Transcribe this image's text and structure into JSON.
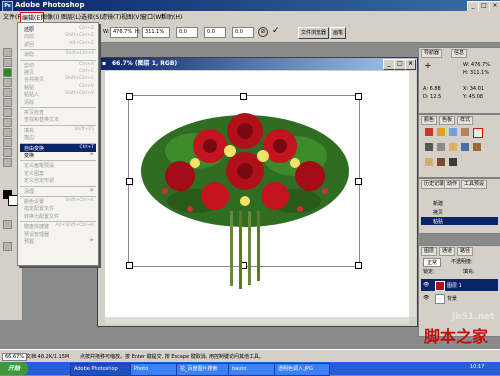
{
  "window": {
    "title": "Adobe Photoshop",
    "app_icon": "ps-logo-icon"
  },
  "menubar": [
    "文件(F)",
    "编辑(E)",
    "图像(I)",
    "图层(L)",
    "选择(S)",
    "滤镜(T)",
    "视图(V)",
    "窗口(W)",
    "帮助(H)"
  ],
  "options": {
    "x": "0.0",
    "w_label": "W:",
    "w": "476.7%",
    "h_label": "H:",
    "h": "311.1%",
    "angle": "0.0",
    "h2": "0.0",
    "v": "0.0",
    "tab": "文件浏览器",
    "tab2": "画笔"
  },
  "edit_menu": [
    {
      "label": "还原",
      "sc": "Ctrl+Z",
      "en": true
    },
    {
      "label": "向前",
      "sc": "Shift+Ctrl+Z",
      "en": false
    },
    {
      "label": "返回",
      "sc": "Alt+Ctrl+Z",
      "en": false
    },
    {
      "sep": true
    },
    {
      "label": "渐隐",
      "sc": "Shift+Ctrl+F",
      "en": false
    },
    {
      "sep": true
    },
    {
      "label": "剪切",
      "sc": "Ctrl+X",
      "en": false
    },
    {
      "label": "拷贝",
      "sc": "Ctrl+C",
      "en": false
    },
    {
      "label": "合并拷贝",
      "sc": "Shift+Ctrl+C",
      "en": false
    },
    {
      "label": "粘贴",
      "sc": "Ctrl+V",
      "en": false
    },
    {
      "label": "粘贴入",
      "sc": "Shift+Ctrl+V",
      "en": false
    },
    {
      "label": "清除",
      "sc": "",
      "en": false
    },
    {
      "sep": true
    },
    {
      "label": "拼写检查",
      "sc": "",
      "en": false
    },
    {
      "label": "查找和替换文本",
      "sc": "",
      "en": false
    },
    {
      "sep": true
    },
    {
      "label": "填充",
      "sc": "Shift+F5",
      "en": false
    },
    {
      "label": "描边",
      "sc": "",
      "en": false
    },
    {
      "sep": true
    },
    {
      "label": "自由变换",
      "sc": "Ctrl+T",
      "en": true,
      "hl": true
    },
    {
      "label": "变换",
      "sc": "▶",
      "en": true
    },
    {
      "sep": true
    },
    {
      "label": "定义画笔预设",
      "sc": "",
      "en": false
    },
    {
      "label": "定义图案",
      "sc": "",
      "en": false
    },
    {
      "label": "定义自定形状",
      "sc": "",
      "en": false
    },
    {
      "sep": true
    },
    {
      "label": "清理",
      "sc": "▶",
      "en": false
    },
    {
      "sep": true
    },
    {
      "label": "颜色设置",
      "sc": "Shift+Ctrl+K",
      "en": false
    },
    {
      "label": "指定配置文件",
      "sc": "",
      "en": false
    },
    {
      "label": "转换为配置文件",
      "sc": "",
      "en": false
    },
    {
      "sep": true
    },
    {
      "label": "键盘快捷键",
      "sc": "Alt+Shift+Ctrl+K",
      "en": false
    },
    {
      "label": "预设管理器",
      "sc": "",
      "en": false
    },
    {
      "label": "预置",
      "sc": "▶",
      "en": false
    }
  ],
  "document": {
    "title": "66.7% (图层 1, RGB)"
  },
  "panels": {
    "nav": {
      "tab1": "导航器",
      "tab2": "信息",
      "w": "W: 476.7%",
      "h": "H: 311.1%",
      "a": "A: 6.88",
      "d": "D: 12.5",
      "x": "X: 34.01",
      "y": "Y: 45.08"
    },
    "color": {
      "tab1": "颜色",
      "tab2": "色板",
      "tab3": "样式"
    },
    "history": {
      "tab1": "历史记录",
      "tab2": "动作",
      "tab3": "工具预设",
      "items": [
        "新建",
        "拷贝",
        "粘贴"
      ]
    },
    "layers": {
      "tab1": "图层",
      "tab2": "通道",
      "tab3": "路径",
      "mode": "正常",
      "opacity": "不透明度:",
      "lock": "锁定:",
      "fill": "填充:",
      "layer1": "图层 1",
      "bg": "背景"
    }
  },
  "status": {
    "zoom": "66.67%",
    "doc": "文档:48.2K/1.15M",
    "hint": "点按并拖移可缩放。按 Enter 键提交, 按 Escape 键取消, 用控制键访问其他工具。"
  },
  "taskbar": {
    "start": "开始",
    "items": [
      "Adobe Photoshop",
      "Photo",
      "花_百度图片搜索",
      "bauto",
      "透明色调入.JPG"
    ],
    "clock": "10:17"
  },
  "watermark": {
    "top": "jb51.net",
    "bottom": "脚本之家"
  }
}
